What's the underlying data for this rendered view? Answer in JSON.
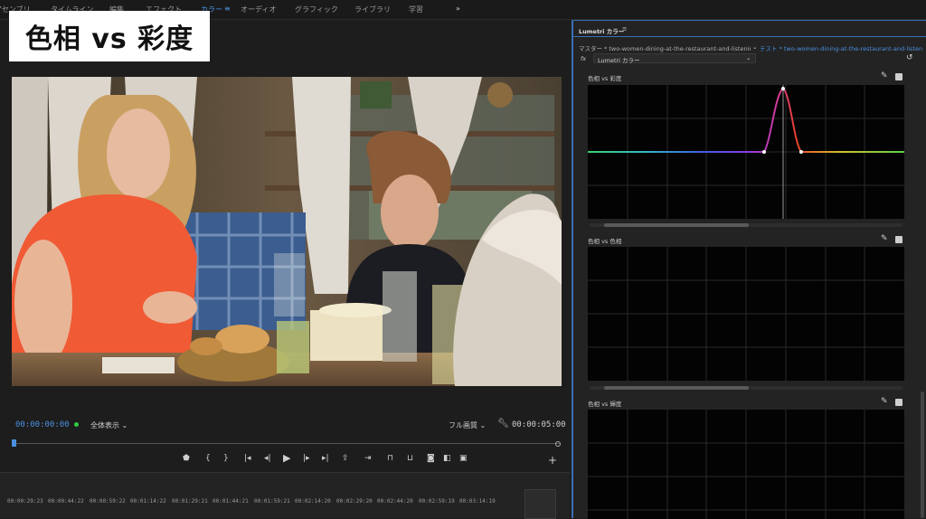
{
  "workspace_tabs": [
    {
      "label": "アセンブリ",
      "active": false
    },
    {
      "label": "タイムライン",
      "active": false
    },
    {
      "label": "編集",
      "active": false
    },
    {
      "label": "エフェクト",
      "active": false
    },
    {
      "label": "カラー",
      "active": true
    },
    {
      "label": "オーディオ",
      "active": false
    },
    {
      "label": "グラフィック",
      "active": false
    },
    {
      "label": "ライブラリ",
      "active": false
    },
    {
      "label": "学習",
      "active": false
    }
  ],
  "overlay_title": "色相 vs 彩度",
  "monitor": {
    "timecode_current": "00:00:00:00",
    "zoom_label": "全体表示",
    "quality_label": "フル画質",
    "timecode_duration": "00:00:05:00"
  },
  "timeline": {
    "ticks": [
      "00:00:29:23",
      "00:00:44:22",
      "00:00:59:22",
      "00:01:14:22",
      "00:01:29:21",
      "00:01:44:21",
      "00:01:59:21",
      "00:02:14:20",
      "00:02:29:20",
      "00:02:44:20",
      "00:02:59:19",
      "00:03:14:19"
    ]
  },
  "panel": {
    "title": "Lumetri カラー",
    "master_label": "マスター * two-women-dining-at-the-restaurant-and-listening-to...",
    "test_label": "テスト * two-women-dining-at-the-restaurant-and-listening-to...",
    "fx_label": "fx",
    "effect_select": "Lumetri カラー",
    "sections": [
      {
        "label": "色相 vs 彩度",
        "enabled": true
      },
      {
        "label": "色相 vs 色相",
        "enabled": true
      },
      {
        "label": "色相 vs 輝度",
        "enabled": true
      }
    ]
  },
  "colors": {
    "accent": "#4a90e2",
    "panel_border": "#3b6fb6",
    "curve_peak": "#e8402a",
    "playhead_marker": "#4a90e2"
  }
}
